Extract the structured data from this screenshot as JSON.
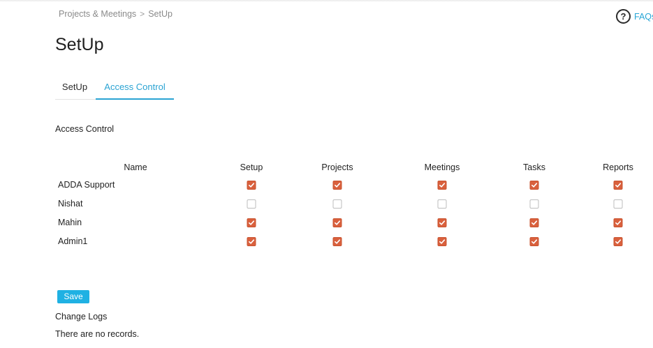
{
  "breadcrumb": {
    "parent": "Projects & Meetings",
    "separator": ">",
    "current": "SetUp"
  },
  "help": {
    "label": "FAQs",
    "icon": "question-circle-icon"
  },
  "page": {
    "title": "SetUp"
  },
  "tabs": [
    {
      "label": "SetUp",
      "active": false
    },
    {
      "label": "Access Control",
      "active": true
    }
  ],
  "access_control": {
    "title": "Access Control",
    "columns": [
      "Name",
      "Setup",
      "Projects",
      "Meetings",
      "Tasks",
      "Reports"
    ],
    "rows": [
      {
        "name": "ADDA Support",
        "permissions": [
          true,
          true,
          true,
          true,
          true
        ]
      },
      {
        "name": "Nishat",
        "permissions": [
          false,
          false,
          false,
          false,
          false
        ]
      },
      {
        "name": "Mahin",
        "permissions": [
          true,
          true,
          true,
          true,
          true
        ]
      },
      {
        "name": "Admin1",
        "permissions": [
          true,
          true,
          true,
          true,
          true
        ]
      }
    ]
  },
  "actions": {
    "save_label": "Save"
  },
  "change_logs": {
    "title": "Change Logs",
    "empty_message": "There are no records."
  },
  "colors": {
    "accent": "#2aa3d3",
    "checkbox_checked": "#d9603d",
    "save_button": "#1fb1e3"
  }
}
